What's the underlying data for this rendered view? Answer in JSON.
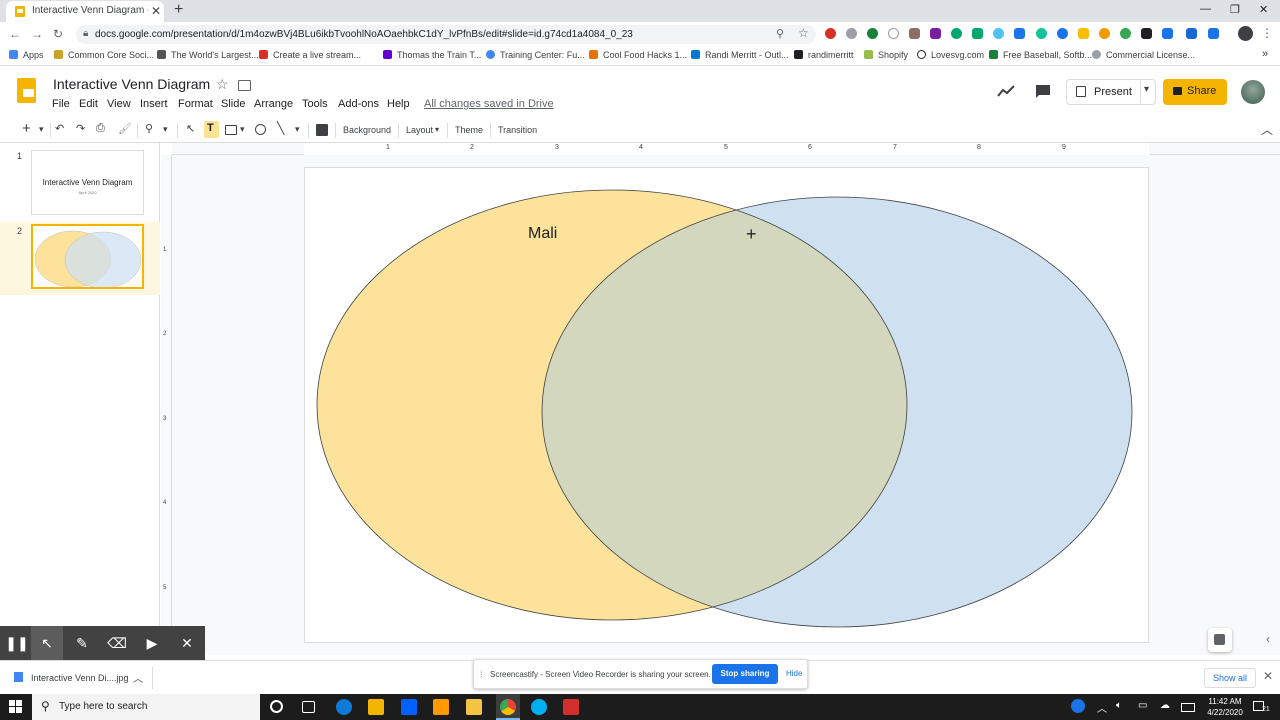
{
  "browser": {
    "tab_title": "Interactive Venn Diagram - Goog",
    "url": "docs.google.com/presentation/d/1m4ozwBVj4BLu6ikbTvoohlNoAOaehbkC1dY_lvPfnBs/edit#slide=id.g74cd1a4084_0_23",
    "bookmarks": [
      {
        "label": "Apps",
        "color": "#4285f4"
      },
      {
        "label": "Common Core Soci...",
        "color": "#c9a227"
      },
      {
        "label": "The World's Largest...",
        "color": "#555555"
      },
      {
        "label": "Create a live stream...",
        "color": "#4285f4"
      },
      {
        "label": "Thomas the Train T...",
        "color": "#5f01d1"
      },
      {
        "label": "Training Center: Fu...",
        "color": "#4285f4"
      },
      {
        "label": "Cool Food Hacks 1...",
        "color": "#e8710a"
      },
      {
        "label": "Randi Merritt - Outl...",
        "color": "#0078d4"
      },
      {
        "label": "randimerritt",
        "color": "#202124"
      },
      {
        "label": "Shopify",
        "color": "#95bf47"
      },
      {
        "label": "Lovesvg.com",
        "color": "#202124"
      },
      {
        "label": "Free Baseball, Softb...",
        "color": "#188038"
      },
      {
        "label": "Commercial License...",
        "color": "#9aa0a6"
      }
    ]
  },
  "slides": {
    "doc_title": "Interactive Venn Diagram",
    "menu": [
      "File",
      "Edit",
      "View",
      "Insert",
      "Format",
      "Slide",
      "Arrange",
      "Tools",
      "Add-ons",
      "Help"
    ],
    "saved_status": "All changes saved in Drive",
    "present_label": "Present",
    "share_label": "Share",
    "toolbar": {
      "background": "Background",
      "layout": "Layout",
      "theme": "Theme",
      "transition": "Transition"
    },
    "thumbnails": [
      {
        "number": "1",
        "title": "Interactive Venn Diagram",
        "subtitle": "April 2020"
      },
      {
        "number": "2",
        "title": "",
        "subtitle": ""
      }
    ],
    "ruler_top": [
      "1",
      "2",
      "3",
      "4",
      "5",
      "6",
      "7",
      "8",
      "9"
    ],
    "ruler_left": [
      "1",
      "2",
      "3",
      "4",
      "5"
    ],
    "slide": {
      "label_left": "Mali",
      "colors": {
        "left_circle": "#fce29a",
        "right_circle": "#cfe0f1",
        "overlap": "#d3d7bd"
      }
    }
  },
  "downloads": {
    "file": "Interactive Venn Di....jpg",
    "show_all": "Show all"
  },
  "screen_share": {
    "message": "Screencastify - Screen Video Recorder is sharing your screen.",
    "stop_label": "Stop sharing",
    "hide_label": "Hide"
  },
  "taskbar": {
    "search_placeholder": "Type here to search",
    "time": "11:42 AM",
    "date": "4/22/2020",
    "notifications": "21"
  }
}
